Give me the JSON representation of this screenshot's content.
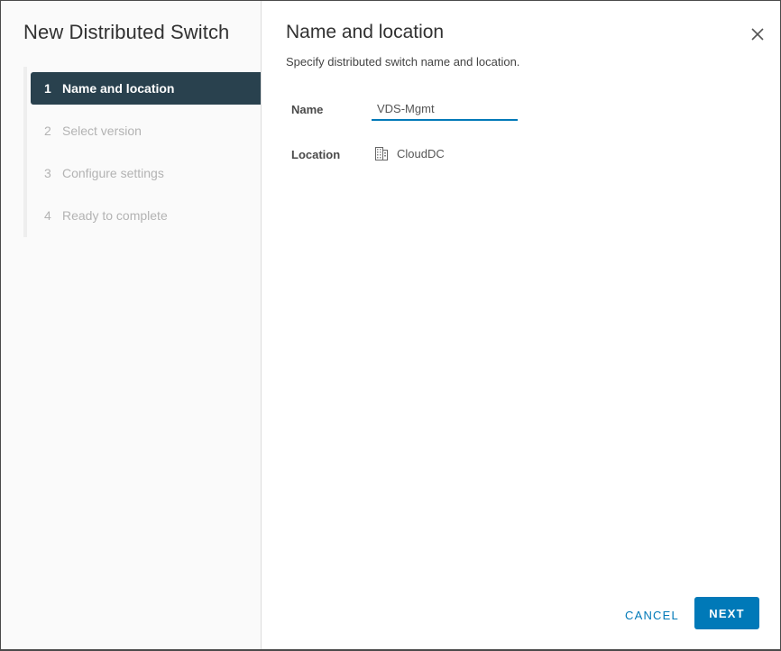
{
  "wizard": {
    "title": "New Distributed Switch",
    "steps": [
      {
        "number": "1",
        "label": "Name and location",
        "state": "active"
      },
      {
        "number": "2",
        "label": "Select version",
        "state": "disabled"
      },
      {
        "number": "3",
        "label": "Configure settings",
        "state": "disabled"
      },
      {
        "number": "4",
        "label": "Ready to complete",
        "state": "disabled"
      }
    ]
  },
  "page": {
    "title": "Name and location",
    "subtitle": "Specify distributed switch name and location.",
    "close_icon": "close-icon"
  },
  "form": {
    "name_label": "Name",
    "name_value": "VDS-Mgmt",
    "location_label": "Location",
    "location_icon": "datacenter-icon",
    "location_value": "CloudDC"
  },
  "footer": {
    "cancel_label": "CANCEL",
    "next_label": "NEXT"
  },
  "colors": {
    "accent": "#0079b8",
    "active_step_bg": "#29414e"
  }
}
